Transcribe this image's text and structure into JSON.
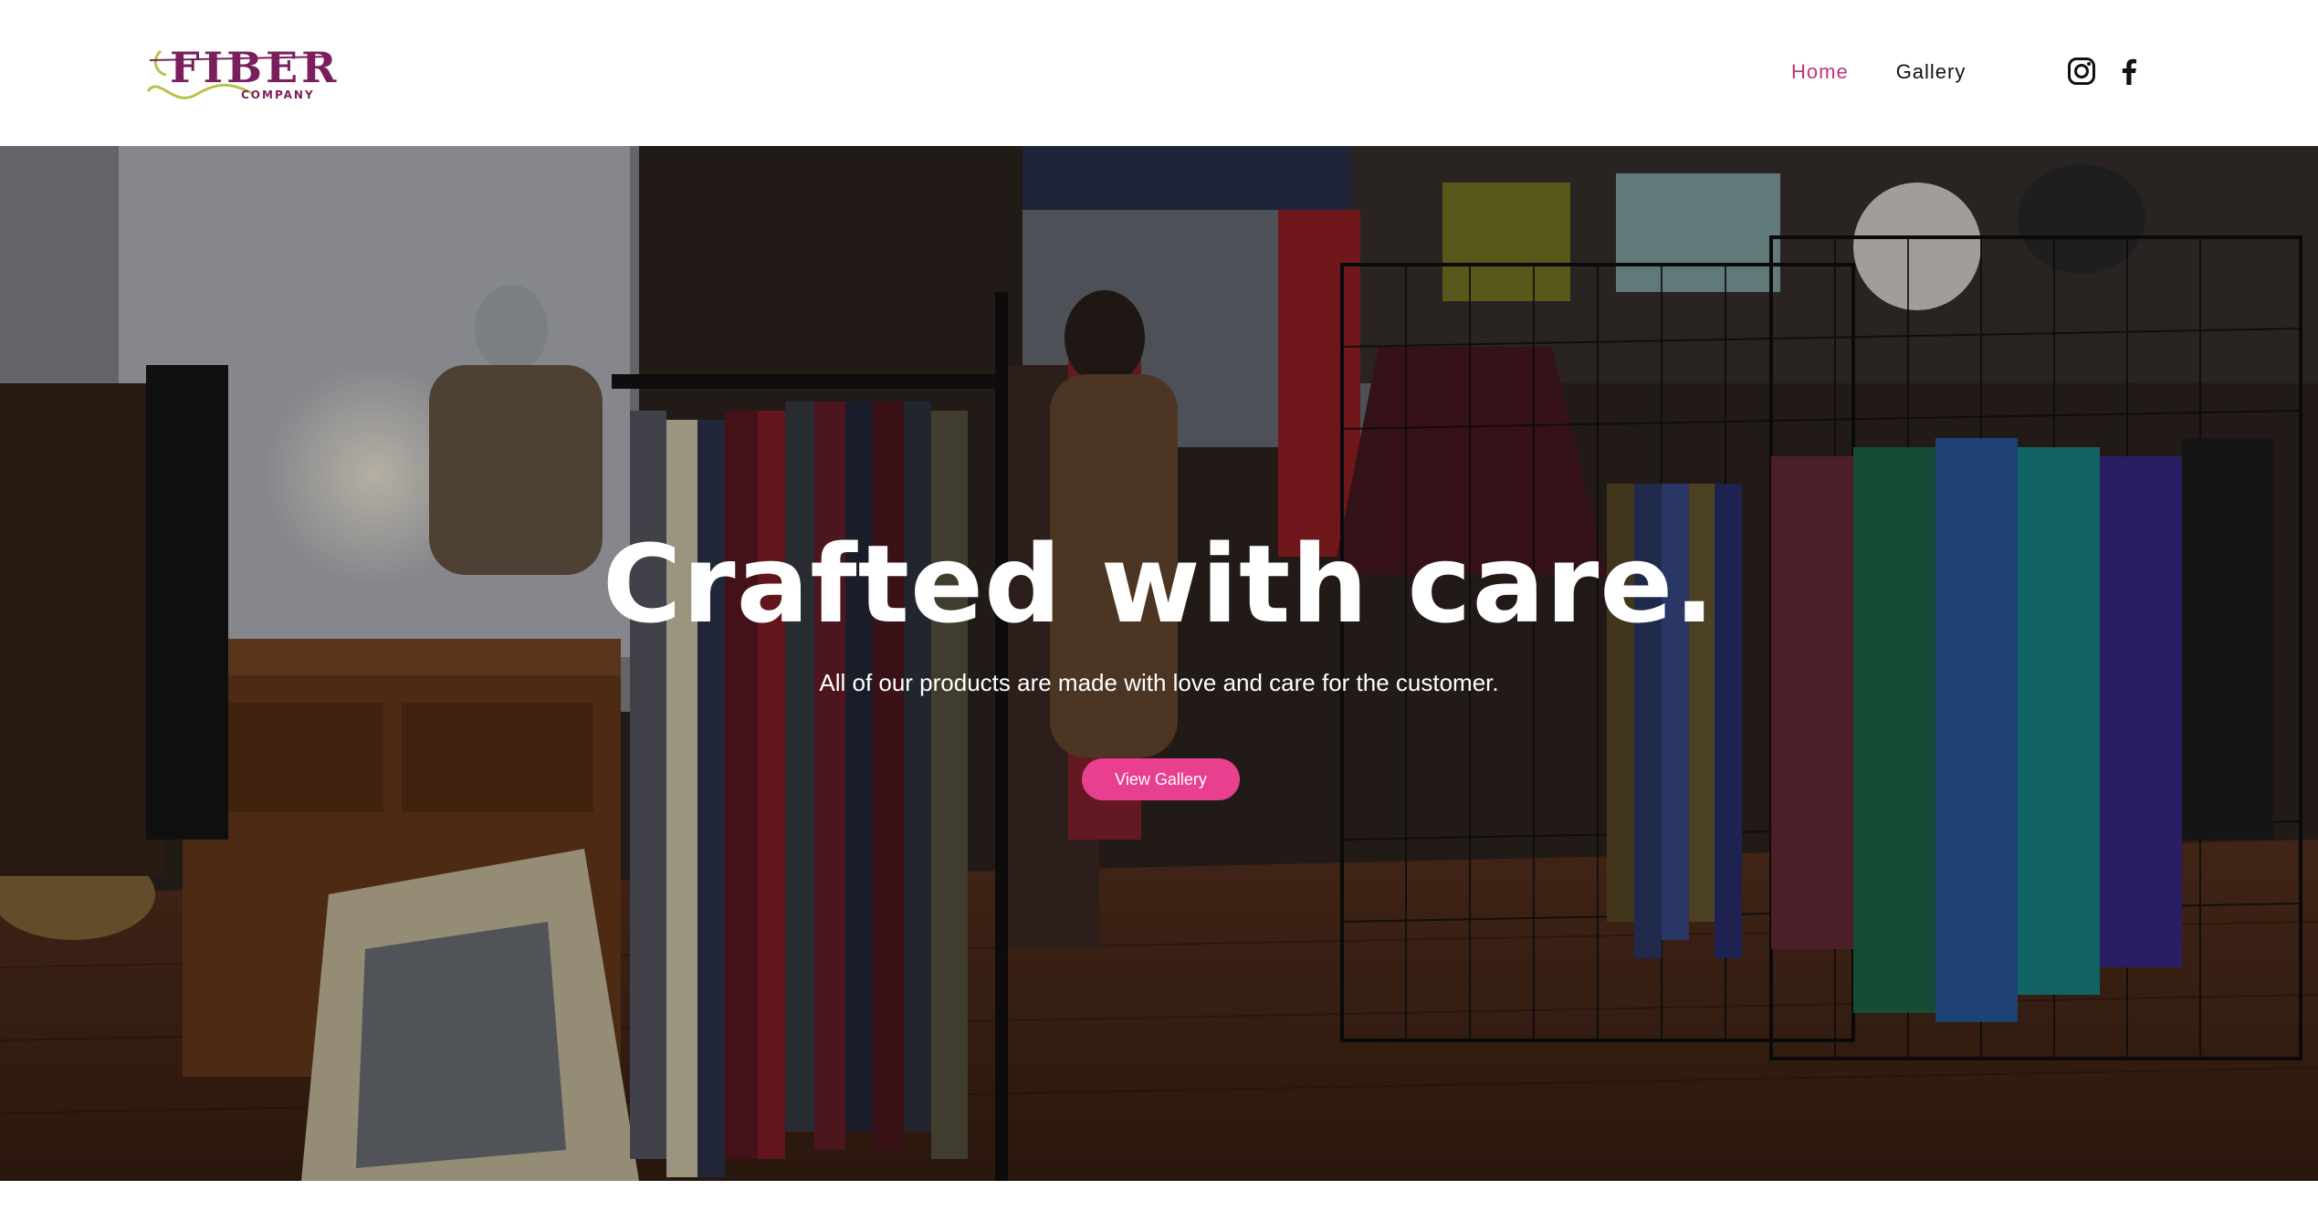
{
  "header": {
    "logo": {
      "wordmark": "FIBER",
      "sub": "COMPANY",
      "icon": "yarn-needle-logo"
    },
    "nav": [
      {
        "label": "Home",
        "active": true
      },
      {
        "label": "Gallery",
        "active": false
      }
    ],
    "social": [
      {
        "icon": "instagram-icon"
      },
      {
        "icon": "facebook-icon"
      }
    ]
  },
  "hero": {
    "title": "Crafted with care.",
    "subtitle": "All of our products are made with love and care for the customer.",
    "button_label": "View Gallery",
    "background": "photo of a boutique interior with racks of scarves, shawls and knitwear"
  },
  "colors": {
    "accent": "#e8408e",
    "nav_active": "#c2337f",
    "logo_purple": "#7a1f5c",
    "logo_green": "#b9c24a",
    "text_dark": "#111111"
  }
}
